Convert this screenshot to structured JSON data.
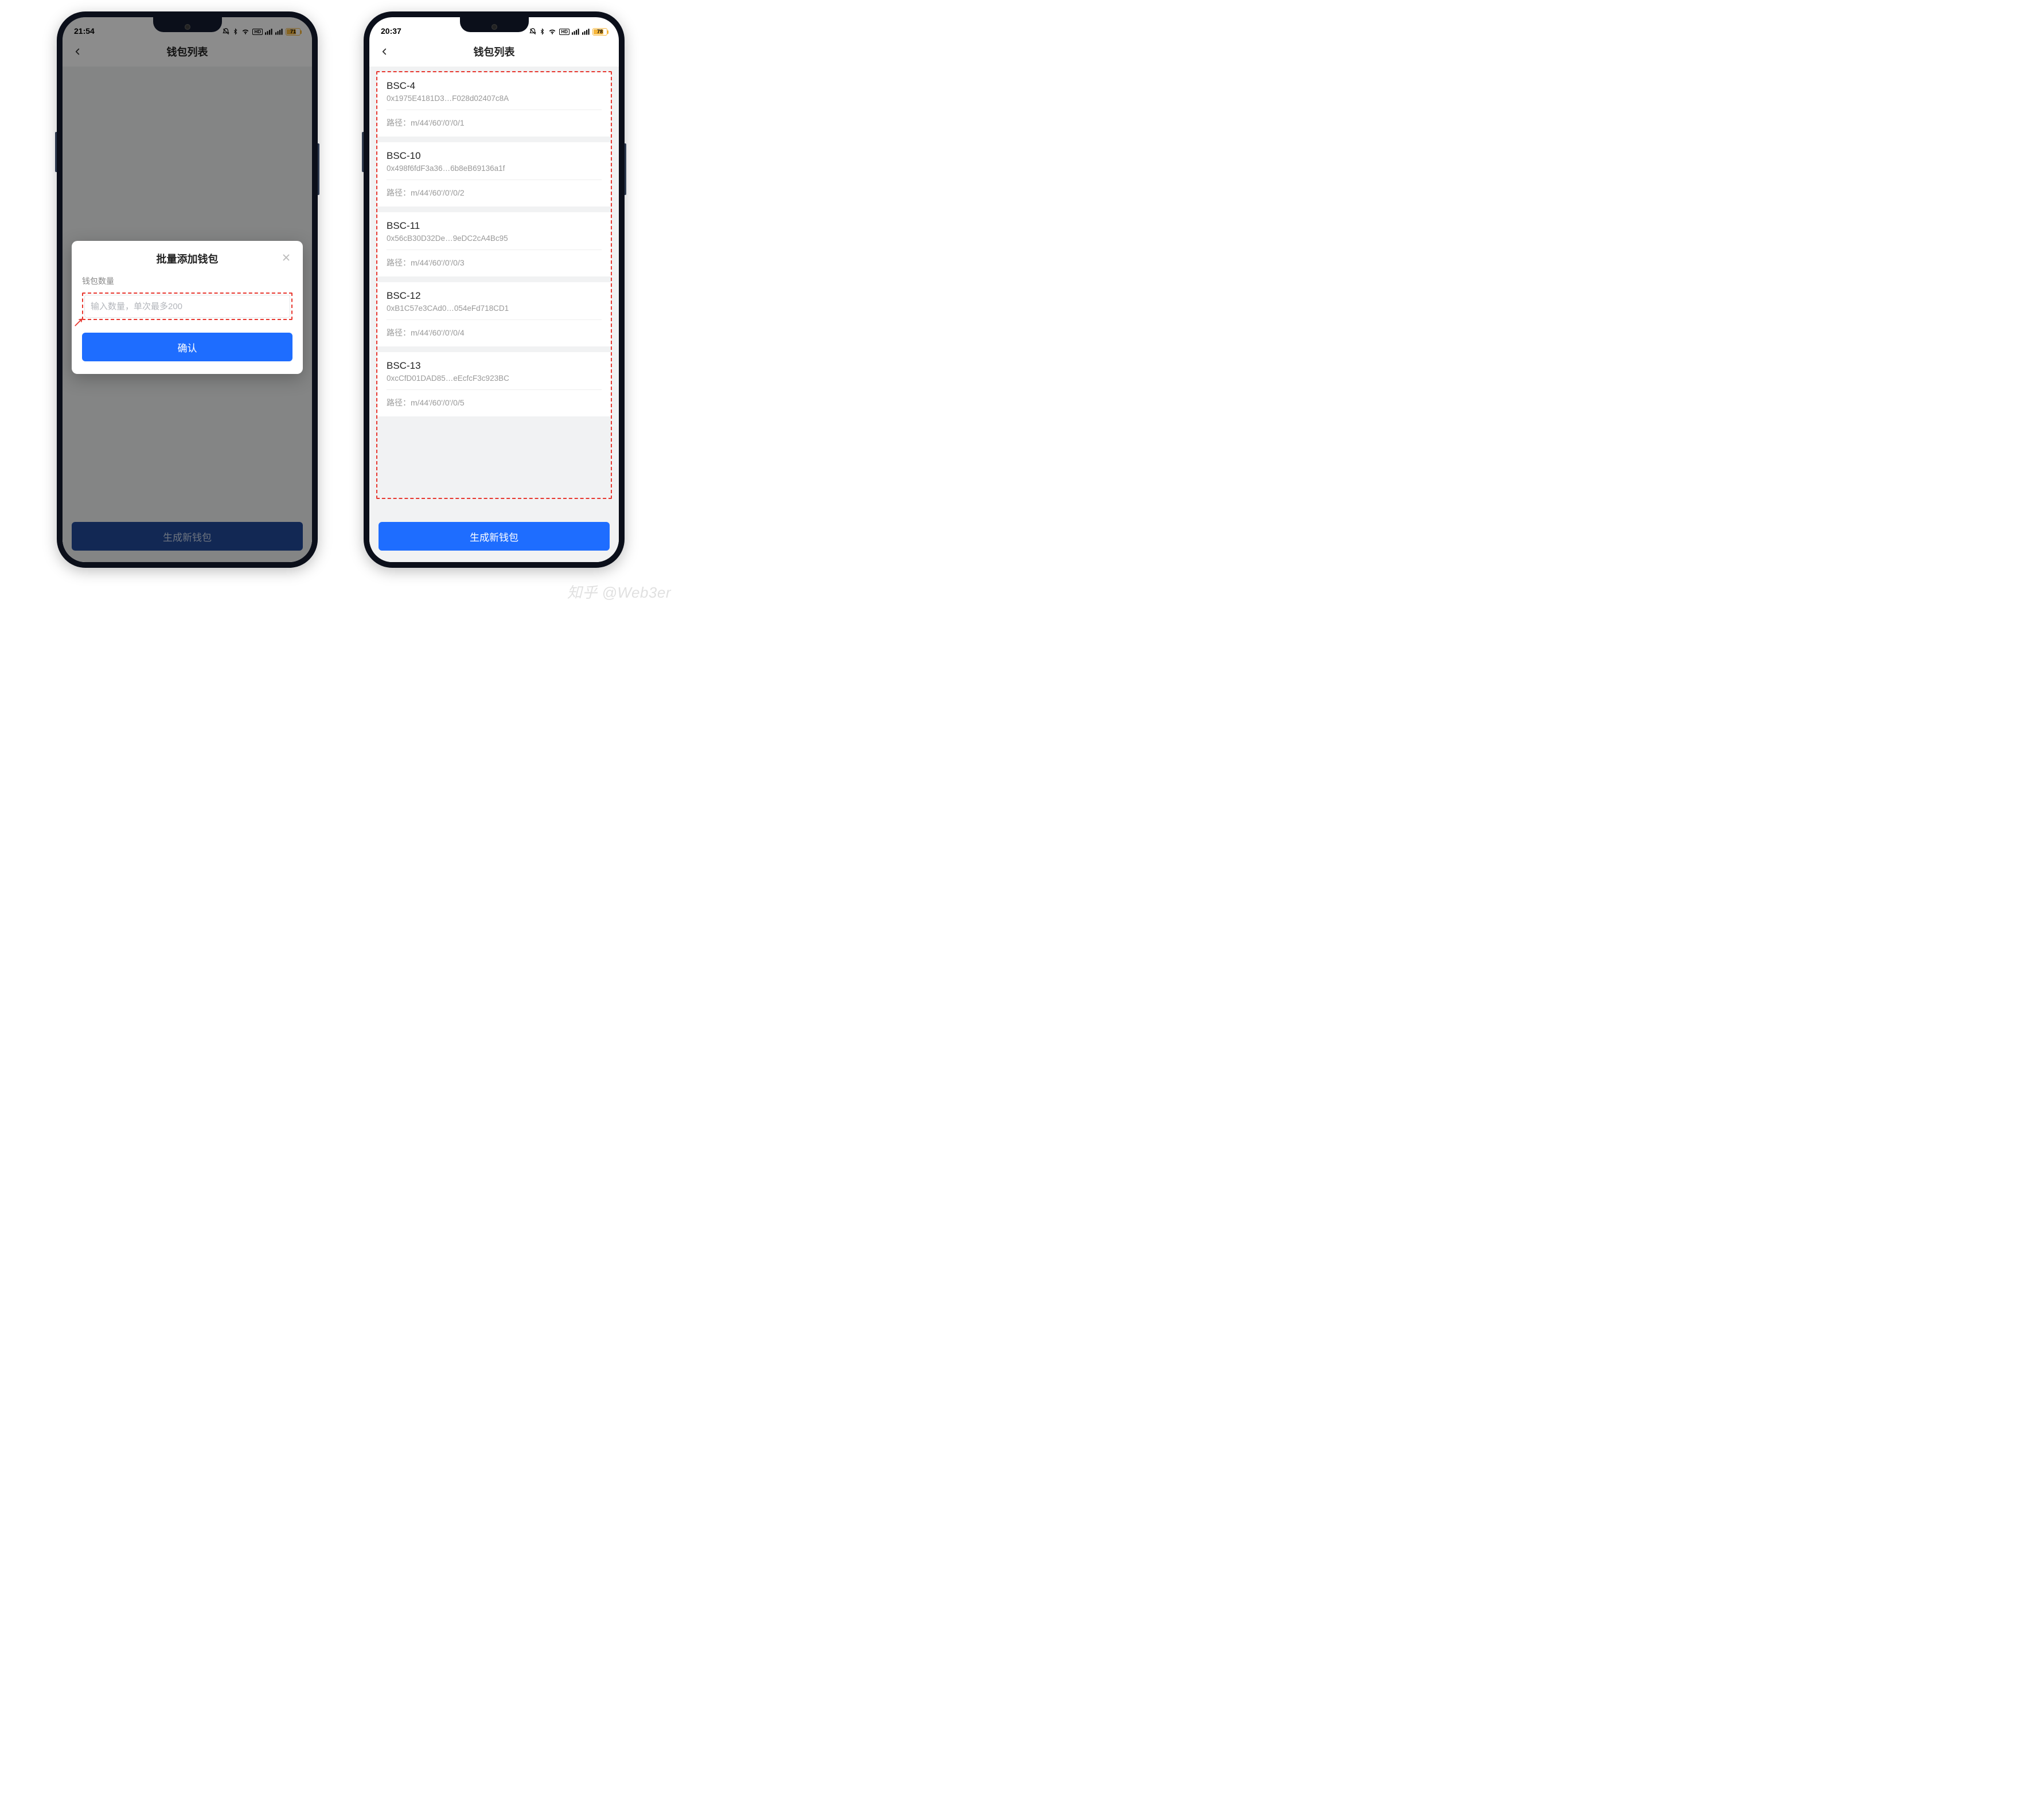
{
  "watermark": "知乎 @Web3er",
  "phone_left": {
    "status": {
      "time": "21:54",
      "battery_pct": 71,
      "battery_text": "71"
    },
    "nav_title": "钱包列表",
    "bottom_button": "生成新钱包",
    "dialog": {
      "title": "批量添加钱包",
      "qty_label": "钱包数量",
      "qty_placeholder": "输入数量，单次最多200",
      "confirm": "确认"
    }
  },
  "phone_right": {
    "status": {
      "time": "20:37",
      "battery_pct": 78,
      "battery_text": "78"
    },
    "nav_title": "钱包列表",
    "bottom_button": "生成新钱包",
    "path_prefix": "路径：",
    "wallets": [
      {
        "name": "BSC-4",
        "addr": "0x1975E4181D3…F028d02407c8A",
        "path": "m/44'/60'/0'/0/1"
      },
      {
        "name": "BSC-10",
        "addr": "0x498f6fdF3a36…6b8eB69136a1f",
        "path": "m/44'/60'/0'/0/2"
      },
      {
        "name": "BSC-11",
        "addr": "0x56cB30D32De…9eDC2cA4Bc95",
        "path": "m/44'/60'/0'/0/3"
      },
      {
        "name": "BSC-12",
        "addr": "0xB1C57e3CAd0…054eFd718CD1",
        "path": "m/44'/60'/0'/0/4"
      },
      {
        "name": "BSC-13",
        "addr": "0xcCfD01DAD85…eEcfcF3c923BC",
        "path": "m/44'/60'/0'/0/5"
      }
    ]
  }
}
